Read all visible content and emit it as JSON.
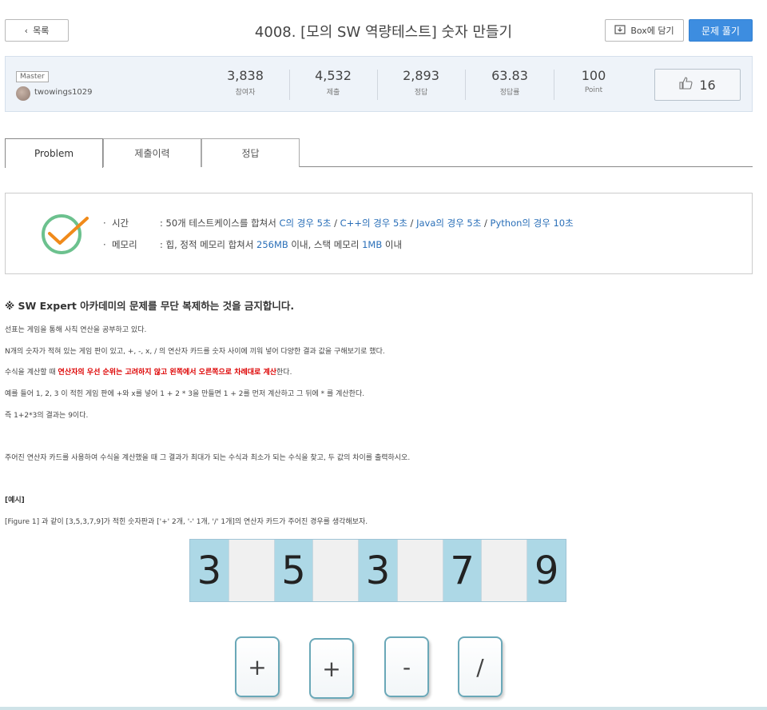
{
  "header": {
    "back_label": "목록",
    "title": "4008. [모의 SW 역량테스트] 숫자 만들기",
    "box_label": "Box에 담기",
    "solve_label": "문제 풀기"
  },
  "stats": {
    "level": "Master",
    "author": "twowings1029",
    "items": [
      {
        "value": "3,838",
        "label": "참여자"
      },
      {
        "value": "4,532",
        "label": "제출"
      },
      {
        "value": "2,893",
        "label": "정답"
      },
      {
        "value": "63.83",
        "label": "정답률"
      },
      {
        "value": "100",
        "label": "Point"
      }
    ],
    "likes": "16"
  },
  "tabs": [
    "Problem",
    "제출이력",
    "정답"
  ],
  "limits": {
    "time_label": "시간",
    "time_prefix": ": 50개 테스트케이스를 합쳐서 ",
    "time_c": "C의 경우 5초",
    "time_cpp": "C++의 경우 5초",
    "time_java": "Java의 경우 5초",
    "time_py": "Python의 경우 10초",
    "sep": " / ",
    "mem_label": "메모리",
    "mem_prefix": ": 힙, 정적 메모리 합쳐서 ",
    "mem_heap": "256MB",
    "mem_mid": " 이내, 스택 메모리 ",
    "mem_stack": "1MB",
    "mem_suffix": " 이내"
  },
  "content": {
    "notice": "※ SW Expert 아카데미의 문제를 무단 복제하는 것을 금지합니다.",
    "p1": "선표는 게임을 통해 사칙 연산을 공부하고 있다.",
    "p2": "N개의 숫자가 적혀 있는 게임 판이 있고, +, -, x, / 의 연산자 카드를 숫자 사이에 끼워 넣어 다양한 결과 값을 구해보기로 했다.",
    "p3_a": "수식을 계산할 때 ",
    "p3_red": "연산자의 우선 순위는 고려하지 않고 왼쪽에서 오른쪽으로 차례대로 계산",
    "p3_b": "한다.",
    "p4": "예를 들어 1, 2, 3 이 적힌 게임 판에 +와 x를 넣어 1 + 2 * 3을 만들면 1 + 2를 먼저 계산하고 그 뒤에 * 를 계산한다.",
    "p5": "즉 1+2*3의 결과는 9이다.",
    "p6": "주어진 연산자 카드를 사용하여 수식을 계산했을 때 그 결과가 최대가 되는 수식과 최소가 되는 수식을 찾고, 두 값의 차이를 출력하시오.",
    "example_title": "[예시]",
    "p7": "[Figure 1] 과 같이 [3,5,3,7,9]가 적힌 숫자판과 ['+' 2개, '-' 1개, '/' 1개]의 연산자 카드가 주어진 경우를 생각해보자."
  },
  "figure": {
    "numbers": [
      "3",
      "5",
      "3",
      "7",
      "9"
    ],
    "operators": [
      "+",
      "+",
      "-",
      "/"
    ]
  }
}
